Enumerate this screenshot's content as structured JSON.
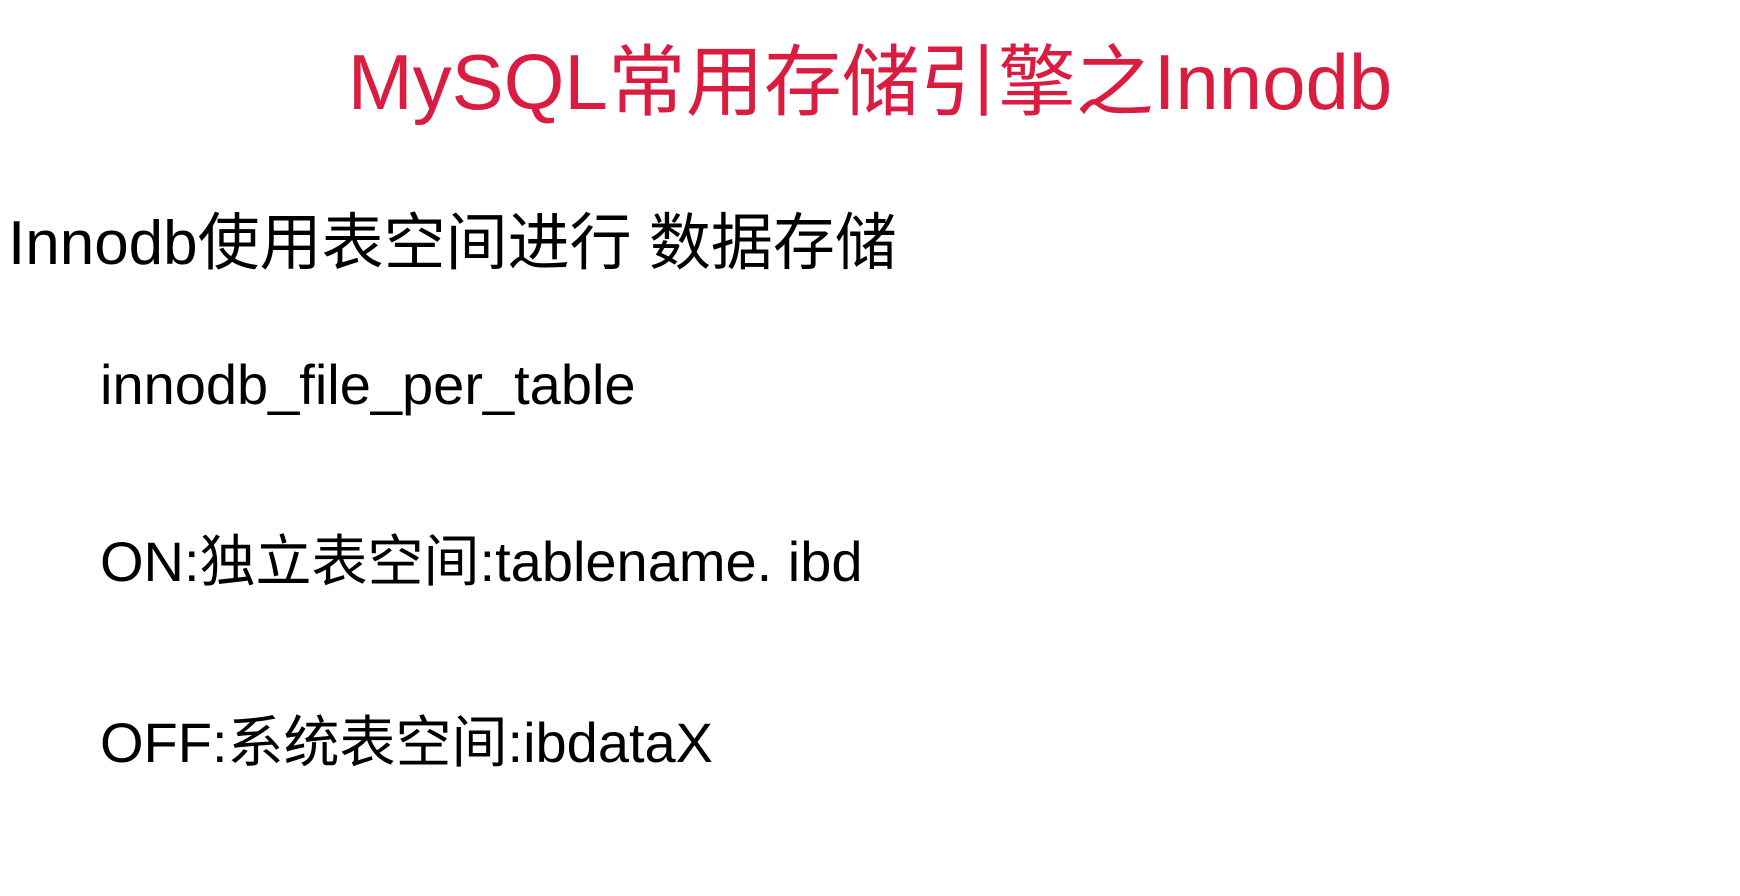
{
  "title": "MySQL常用存储引擎之Innodb",
  "subtitle": "Innodb使用表空间进行 数据存储",
  "lines": {
    "param": "innodb_file_per_table",
    "on": "ON:独立表空间:tablename. ibd",
    "off": "OFF:系统表空间:ibdataX"
  }
}
